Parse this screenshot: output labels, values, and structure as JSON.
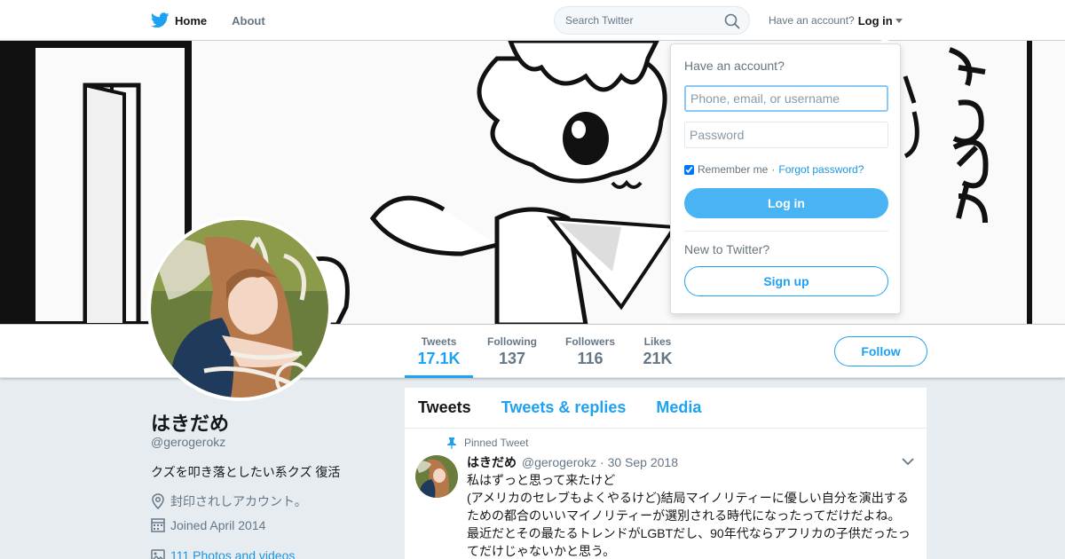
{
  "nav": {
    "home_label": "Home",
    "about_label": "About",
    "search_placeholder": "Search Twitter",
    "have_account": "Have an account?",
    "login_label": "Log in"
  },
  "profile": {
    "name": "はきだめ",
    "handle": "@gerogerokz",
    "bio": "クズを叩き落としたい系クズ 復活",
    "location": "封印されしアカウント。",
    "joined": "Joined April 2014",
    "photos": "111 Photos and videos"
  },
  "stats": [
    {
      "label": "Tweets",
      "value": "17.1K"
    },
    {
      "label": "Following",
      "value": "137"
    },
    {
      "label": "Followers",
      "value": "116"
    },
    {
      "label": "Likes",
      "value": "21K"
    }
  ],
  "follow_label": "Follow",
  "timeline": {
    "tabs": [
      "Tweets",
      "Tweets & replies",
      "Media"
    ],
    "pinned_label": "Pinned Tweet",
    "tweet": {
      "name": "はきだめ",
      "handle": "@gerogerokz",
      "date": "· 30 Sep 2018",
      "lines": [
        "私はずっと思って来たけど",
        "(アメリカのセレブもよくやるけど)結局マイノリティーに優しい自分を演出する",
        "ための都合のいいマイノリティーが選別される時代になったってだけだよね。",
        "最近だとその最たるトレンドがLGBTだし、90年代ならアフリカの子供だったっ",
        "てだけじゃないかと思う。"
      ]
    }
  },
  "login_dropdown": {
    "title": "Have an account?",
    "username_placeholder": "Phone, email, or username",
    "password_placeholder": "Password",
    "remember": "Remember me",
    "separator": "·",
    "forgot": "Forgot password?",
    "login_button": "Log in",
    "new_to_twitter": "New to Twitter?",
    "signup_button": "Sign up"
  },
  "colors": {
    "accent": "#1da1f2",
    "login_button": "#4ab3f4",
    "background": "#e6ecf0"
  },
  "icons": [
    "twitter-bird-icon",
    "search-icon",
    "caret-down-icon",
    "location-icon",
    "calendar-icon",
    "photo-icon",
    "pin-icon",
    "chevron-down-icon"
  ]
}
